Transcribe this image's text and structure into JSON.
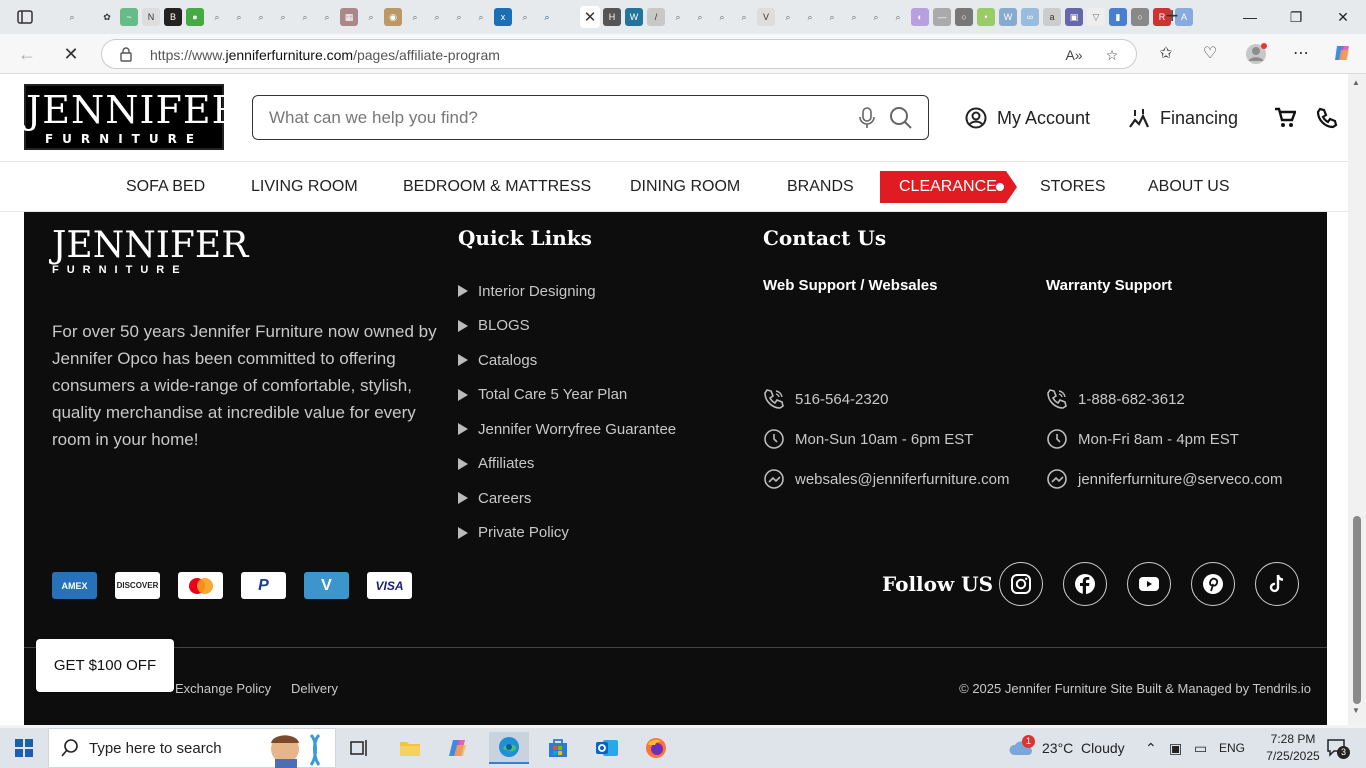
{
  "browser": {
    "url_prefix": "https://www.",
    "url_domain": "jenniferfurniture.com",
    "url_path": "/pages/affiliate-program"
  },
  "header": {
    "logo_main": "JENNIFER",
    "logo_sub": "FURNITURE",
    "search_placeholder": "What can we help you find?",
    "account_label": "My Account",
    "financing_label": "Financing"
  },
  "nav": {
    "items": [
      "SOFA BED",
      "LIVING ROOM",
      "BEDROOM & MATTRESS",
      "DINING ROOM",
      "BRANDS",
      "CLEARANCE",
      "STORES",
      "ABOUT US"
    ]
  },
  "footer": {
    "logo_main": "JENNIFER",
    "logo_sub": "FURNITURE",
    "about": "For over 50 years Jennifer Furniture now owned by Jennifer Opco has been committed to offering consumers a wide-range of comfortable, stylish, quality merchandise at incredible value for every room in your home!",
    "quick_links_title": "Quick Links",
    "quick_links": [
      "Interior Designing",
      "BLOGS",
      "Catalogs",
      "Total Care 5 Year Plan",
      "Jennifer Worryfree Guarantee",
      "Affiliates",
      "Careers",
      "Private Policy"
    ],
    "contact_title": "Contact Us",
    "web_support": {
      "title": "Web Support / Websales",
      "phone": "516-564-2320",
      "hours": "Mon-Sun 10am - 6pm EST",
      "email": "websales@jenniferfurniture.com"
    },
    "warranty_support": {
      "title": "Warranty Support",
      "phone": "1-888-682-3612",
      "hours": "Mon-Fri 8am - 4pm EST",
      "email": "jenniferfurniture@serveco.com"
    },
    "payments": [
      "AMEX",
      "DISCOVER",
      "Mastercard",
      "PayPal",
      "Venmo",
      "VISA"
    ],
    "follow_label": "Follow US",
    "bottom_links": [
      "Exchange Policy",
      "Delivery"
    ],
    "copyright": "© 2025 Jennifer Furniture Site Built & Managed by Tendrils.io",
    "promo": "GET $100 OFF"
  },
  "taskbar": {
    "search_placeholder": "Type here to search",
    "weather": "23°C  Cloudy",
    "weather_badge": "1",
    "lang": "ENG",
    "time": "7:28 PM",
    "date": "7/25/2025",
    "notifications": "3"
  },
  "colors": {
    "accent_red": "#e11b22",
    "footer_bg": "#0d0d0d"
  }
}
